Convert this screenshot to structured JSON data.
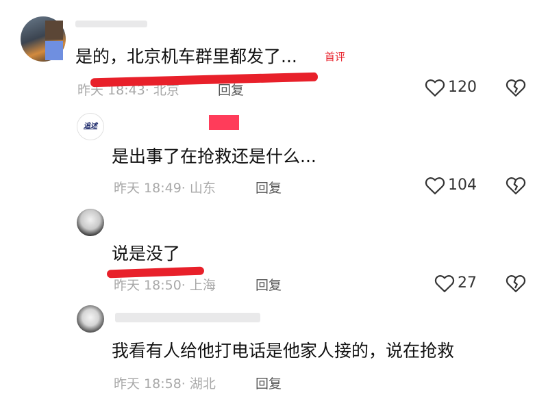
{
  "colors": {
    "accent_red": "#e8202a",
    "meta_gray": "#a8a8a8",
    "text": "#111111"
  },
  "comments": [
    {
      "text": "是的，北京机车群里都发了...",
      "badge": "首评",
      "time": "昨天 18:43",
      "sep": "·",
      "location": "北京",
      "reply": "回复",
      "likes": "120"
    },
    {
      "avatar_text": "追述",
      "text": "是出事了在抢救还是什么...",
      "time": "昨天 18:49",
      "sep": "·",
      "location": "山东",
      "reply": "回复",
      "likes": "104"
    },
    {
      "text": "说是没了",
      "time": "昨天 18:50",
      "sep": "·",
      "location": "上海",
      "reply": "回复",
      "likes": "27"
    },
    {
      "text": "我看有人给他打电话是他家人接的，说在抢救",
      "time": "昨天 18:58",
      "sep": "·",
      "location": "湖北",
      "reply": "回复"
    }
  ],
  "icons": {
    "like": "heart-outline-icon",
    "dislike": "broken-heart-icon"
  }
}
